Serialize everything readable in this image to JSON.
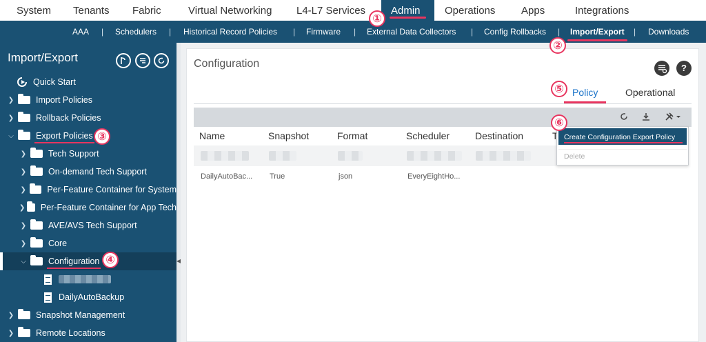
{
  "topnav": {
    "tabs": [
      {
        "label": "System"
      },
      {
        "label": "Tenants"
      },
      {
        "label": "Fabric"
      },
      {
        "label": "Virtual Networking"
      },
      {
        "label": "L4-L7 Services"
      },
      {
        "label": "Admin"
      },
      {
        "label": "Operations"
      },
      {
        "label": "Apps"
      },
      {
        "label": "Integrations"
      }
    ]
  },
  "subnav": {
    "items": [
      {
        "label": "AAA"
      },
      {
        "label": "Schedulers"
      },
      {
        "label": "Historical Record Policies"
      },
      {
        "label": "Firmware"
      },
      {
        "label": "External Data Collectors"
      },
      {
        "label": "Config Rollbacks"
      },
      {
        "label": "Import/Export"
      },
      {
        "label": "Downloads"
      }
    ],
    "separator": "|"
  },
  "badges": [
    "①",
    "②",
    "③",
    "④",
    "⑤",
    "⑥"
  ],
  "sidebar": {
    "title": "Import/Export",
    "tree": [
      {
        "label": "Quick Start"
      },
      {
        "label": "Import Policies"
      },
      {
        "label": "Rollback Policies"
      },
      {
        "label": "Export Policies"
      },
      {
        "label": "Tech Support"
      },
      {
        "label": "On-demand Tech Support"
      },
      {
        "label": "Per-Feature Container for System"
      },
      {
        "label": "Per-Feature Container for App Tech"
      },
      {
        "label": "AVE/AVS Tech Support"
      },
      {
        "label": "Core"
      },
      {
        "label": "Configuration"
      },
      {
        "label": ""
      },
      {
        "label": "DailyAutoBackup"
      },
      {
        "label": "Snapshot Management"
      },
      {
        "label": "Remote Locations"
      }
    ]
  },
  "main": {
    "title": "Configuration",
    "tabs": [
      {
        "label": "Policy"
      },
      {
        "label": "Operational"
      }
    ],
    "table": {
      "columns": [
        "Name",
        "Snapshot",
        "Format",
        "Scheduler",
        "Destination",
        "T"
      ],
      "rows": [
        {
          "name": "DailyAutoBac...",
          "snapshot": "True",
          "format": "json",
          "scheduler": "EveryEightHo..."
        }
      ]
    },
    "menu": {
      "items": [
        {
          "label": "Create Configuration Export Policy"
        },
        {
          "label": "Delete"
        }
      ]
    }
  },
  "colors": {
    "navy": "#1a5173",
    "accent": "#e8355f",
    "link": "#1a73c9"
  }
}
